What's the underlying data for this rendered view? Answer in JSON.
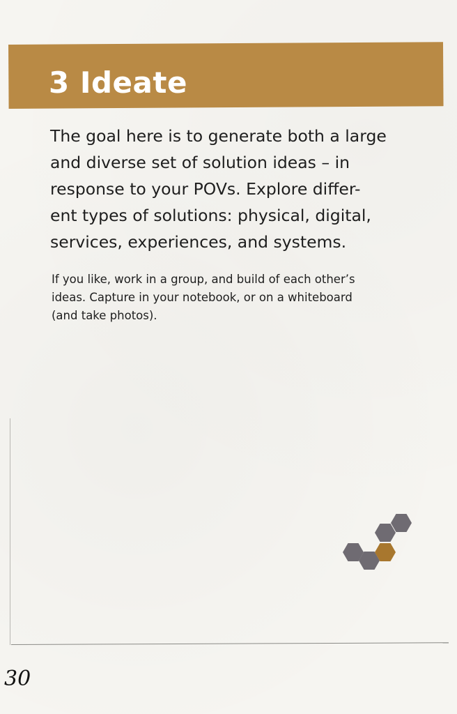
{
  "section": {
    "title": "3 Ideate"
  },
  "body": {
    "intro_lines": [
      "The goal here is to generate both a large",
      "and diverse set of solution ideas – in",
      "response to your POVs.  Explore differ-",
      "ent types of solutions: physical, digital,",
      "services, experiences, and systems."
    ],
    "note_lines": [
      "If you like, work in a group, and build of each other’s",
      "ideas.  Capture in your notebook, or on a whiteboard",
      "(and take photos)."
    ]
  },
  "footer": {
    "page_number": "30"
  },
  "colors": {
    "header_band": "#b98a45",
    "hex_gray": "#6f6b72",
    "hex_accent": "#a8772e"
  },
  "icons": {
    "decoration": "hexagon-cluster-icon"
  }
}
